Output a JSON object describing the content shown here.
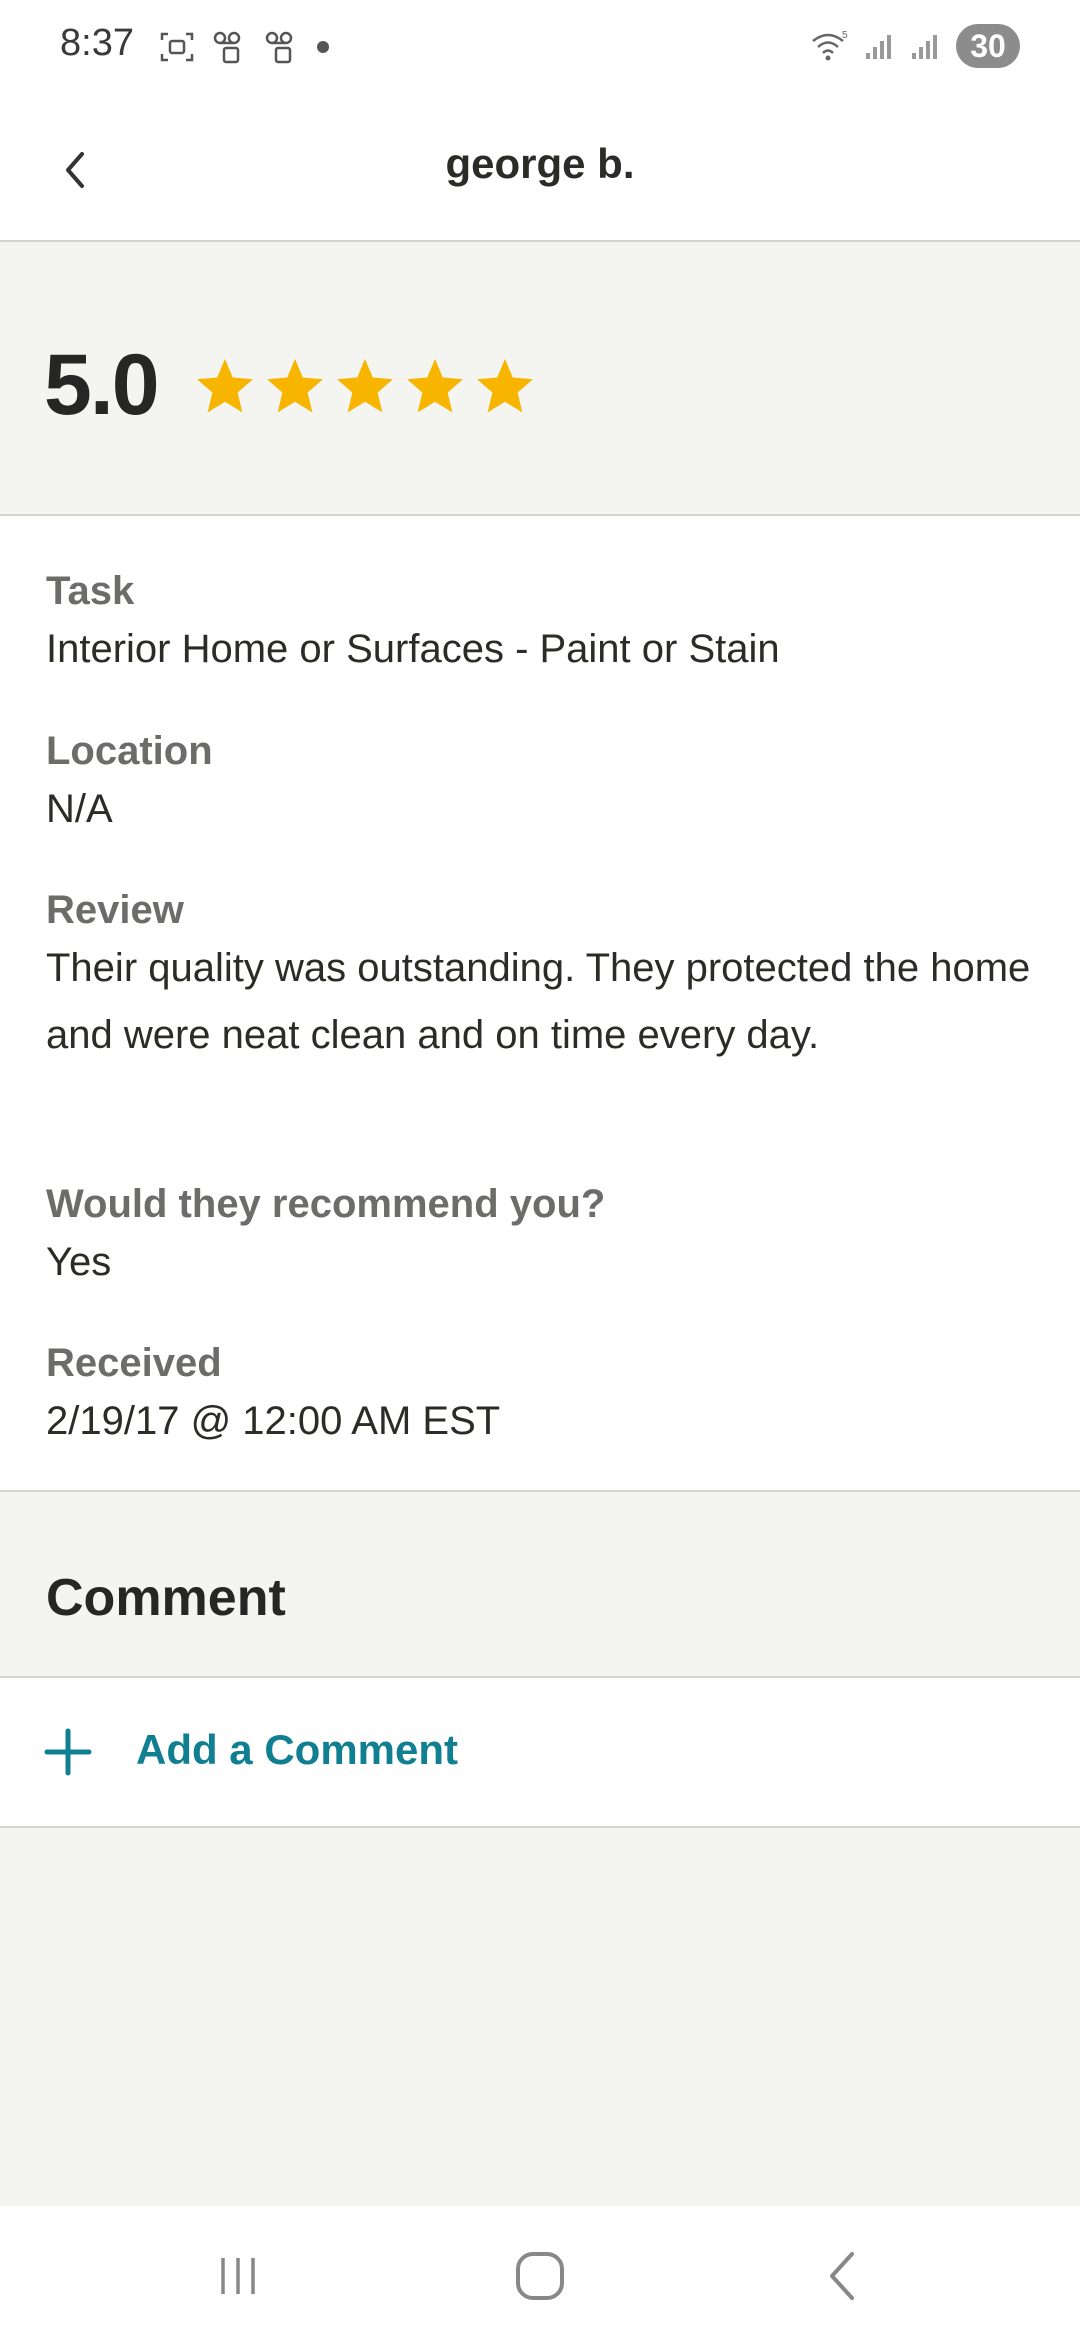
{
  "status_bar": {
    "time": "8:37",
    "battery": "30",
    "icons_left": [
      "screenshot-icon",
      "voicemail-icon",
      "voicemail-icon",
      "notification-dot-icon"
    ],
    "icons_right": [
      "wifi-icon",
      "signal-icon",
      "signal-icon",
      "battery-icon"
    ]
  },
  "header": {
    "title": "george b."
  },
  "rating": {
    "value": "5.0",
    "stars": 5,
    "star_color": "#f7b500"
  },
  "details": {
    "task_label": "Task",
    "task_value": "Interior Home or Surfaces - Paint or Stain",
    "location_label": "Location",
    "location_value": "N/A",
    "review_label": "Review",
    "review_value": "Their quality was outstanding. They protected the home and were neat clean and on time every day.",
    "recommend_label": "Would they recommend you?",
    "recommend_value": "Yes",
    "received_label": "Received",
    "received_value": "2/19/17 @ 12:00 AM EST"
  },
  "comment": {
    "title": "Comment",
    "add_label": "Add a Comment",
    "accent_color": "#117f92"
  },
  "nav_bar": {
    "buttons": [
      "recent-apps-icon",
      "home-icon",
      "back-icon"
    ]
  }
}
